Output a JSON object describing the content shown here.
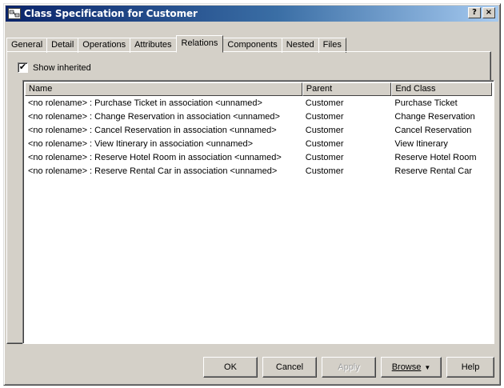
{
  "window": {
    "title": "Class Specification for Customer",
    "help_button": "?",
    "close_button": "×"
  },
  "tabs": [
    {
      "label": "General",
      "active": false
    },
    {
      "label": "Detail",
      "active": false
    },
    {
      "label": "Operations",
      "active": false
    },
    {
      "label": "Attributes",
      "active": false
    },
    {
      "label": "Relations",
      "active": true
    },
    {
      "label": "Components",
      "active": false
    },
    {
      "label": "Nested",
      "active": false
    },
    {
      "label": "Files",
      "active": false
    }
  ],
  "show_inherited": {
    "label": "Show inherited",
    "checked": true,
    "check_mark": "✔"
  },
  "table": {
    "columns": [
      "Name",
      "Parent",
      "End Class"
    ],
    "rows": [
      {
        "name": "<no rolename> : Purchase Ticket in association <unnamed>",
        "parent": "Customer",
        "end_class": "Purchase Ticket"
      },
      {
        "name": "<no rolename> : Change Reservation in association <unnamed>",
        "parent": "Customer",
        "end_class": "Change Reservation"
      },
      {
        "name": "<no rolename> : Cancel Reservation in association <unnamed>",
        "parent": "Customer",
        "end_class": "Cancel Reservation"
      },
      {
        "name": "<no rolename> : View Itinerary in association <unnamed>",
        "parent": "Customer",
        "end_class": "View Itinerary"
      },
      {
        "name": "<no rolename> : Reserve Hotel Room in association <unnamed>",
        "parent": "Customer",
        "end_class": "Reserve Hotel Room"
      },
      {
        "name": "<no rolename> : Reserve Rental Car in association <unnamed>",
        "parent": "Customer",
        "end_class": "Reserve Rental Car"
      }
    ]
  },
  "buttons": {
    "ok": "OK",
    "cancel": "Cancel",
    "apply": "Apply",
    "browse": "Browse",
    "browse_arrow": "▼",
    "help": "Help"
  },
  "colors": {
    "title_gradient_start": "#0a246a",
    "title_gradient_end": "#a6caf0",
    "dialog_face": "#d4d0c8"
  }
}
